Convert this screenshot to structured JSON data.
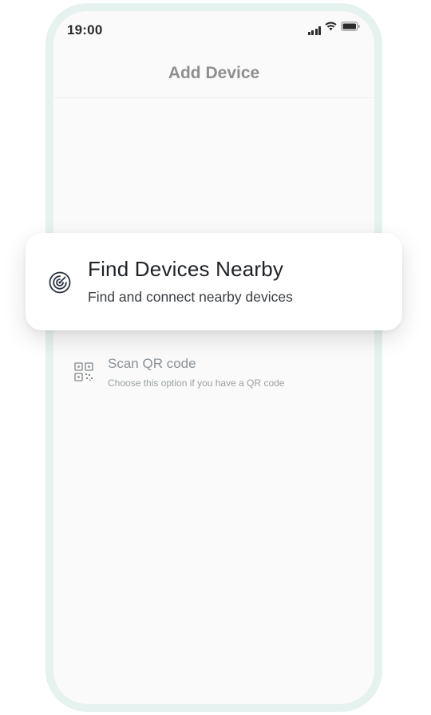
{
  "status_bar": {
    "time": "19:00",
    "icons": [
      "signal-icon",
      "wifi-icon",
      "battery-icon"
    ]
  },
  "header": {
    "title": "Add Device"
  },
  "options": {
    "find_nearby": {
      "icon": "radar-icon",
      "title": "Find Devices Nearby",
      "subtitle": "Find and connect nearby devices"
    },
    "scan_qr": {
      "icon": "qr-code-icon",
      "title": "Scan QR code",
      "subtitle": "Choose this option if you have a QR code"
    }
  },
  "colors": {
    "frame": "#e6f2ef",
    "screen": "#fafafa",
    "card": "#ffffff",
    "title_text": "#1f2327",
    "muted_text": "#8a9196"
  }
}
